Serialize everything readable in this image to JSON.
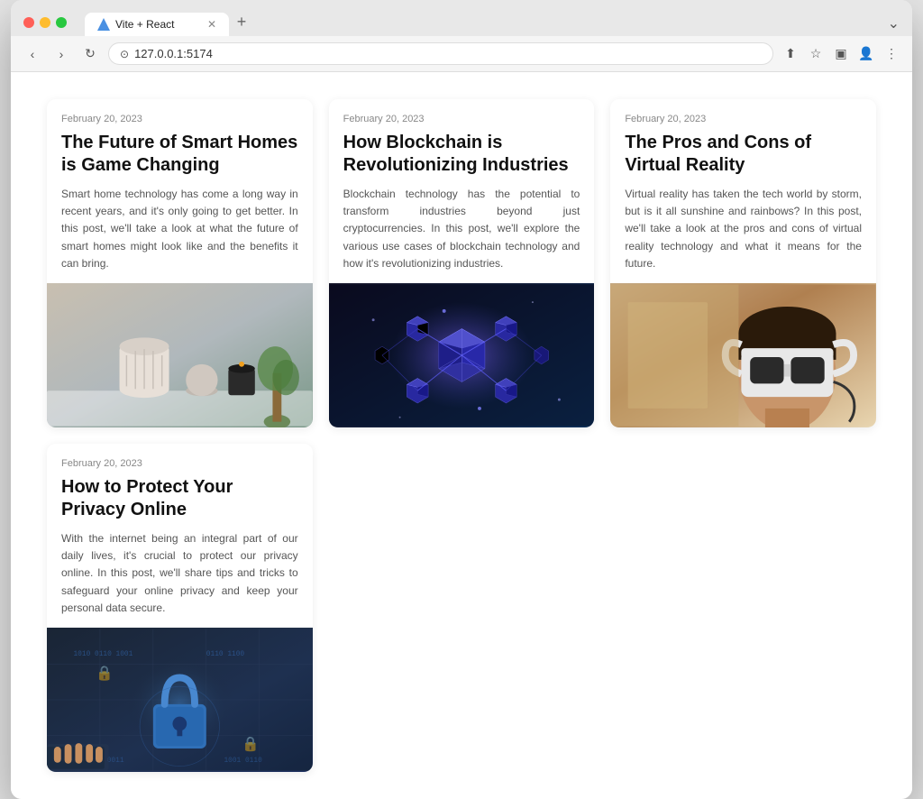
{
  "browser": {
    "tab_title": "Vite + React",
    "url": "127.0.0.1:5174",
    "url_display": "⊙ 127.0.0.1:5174"
  },
  "cards": [
    {
      "id": "smart-homes",
      "date": "February 20, 2023",
      "title": "The Future of Smart Homes is Game Changing",
      "excerpt": "Smart home technology has come a long way in recent years, and it's only going to get better. In this post, we'll take a look at what the future of smart homes might look like and the benefits it can bring.",
      "image_type": "smarthome"
    },
    {
      "id": "blockchain",
      "date": "February 20, 2023",
      "title": "How Blockchain is Revolutionizing Industries",
      "excerpt": "Blockchain technology has the potential to transform industries beyond just cryptocurrencies. In this post, we'll explore the various use cases of blockchain technology and how it's revolutionizing industries.",
      "image_type": "blockchain"
    },
    {
      "id": "vr",
      "date": "February 20, 2023",
      "title": "The Pros and Cons of Virtual Reality",
      "excerpt": "Virtual reality has taken the tech world by storm, but is it all sunshine and rainbows? In this post, we'll take a look at the pros and cons of virtual reality technology and what it means for the future.",
      "image_type": "vr"
    },
    {
      "id": "privacy",
      "date": "February 20, 2023",
      "title": "How to Protect Your Privacy Online",
      "excerpt": "With the internet being an integral part of our daily lives, it's crucial to protect our privacy online. In this post, we'll share tips and tricks to safeguard your online privacy and keep your personal data secure.",
      "image_type": "privacy"
    }
  ]
}
